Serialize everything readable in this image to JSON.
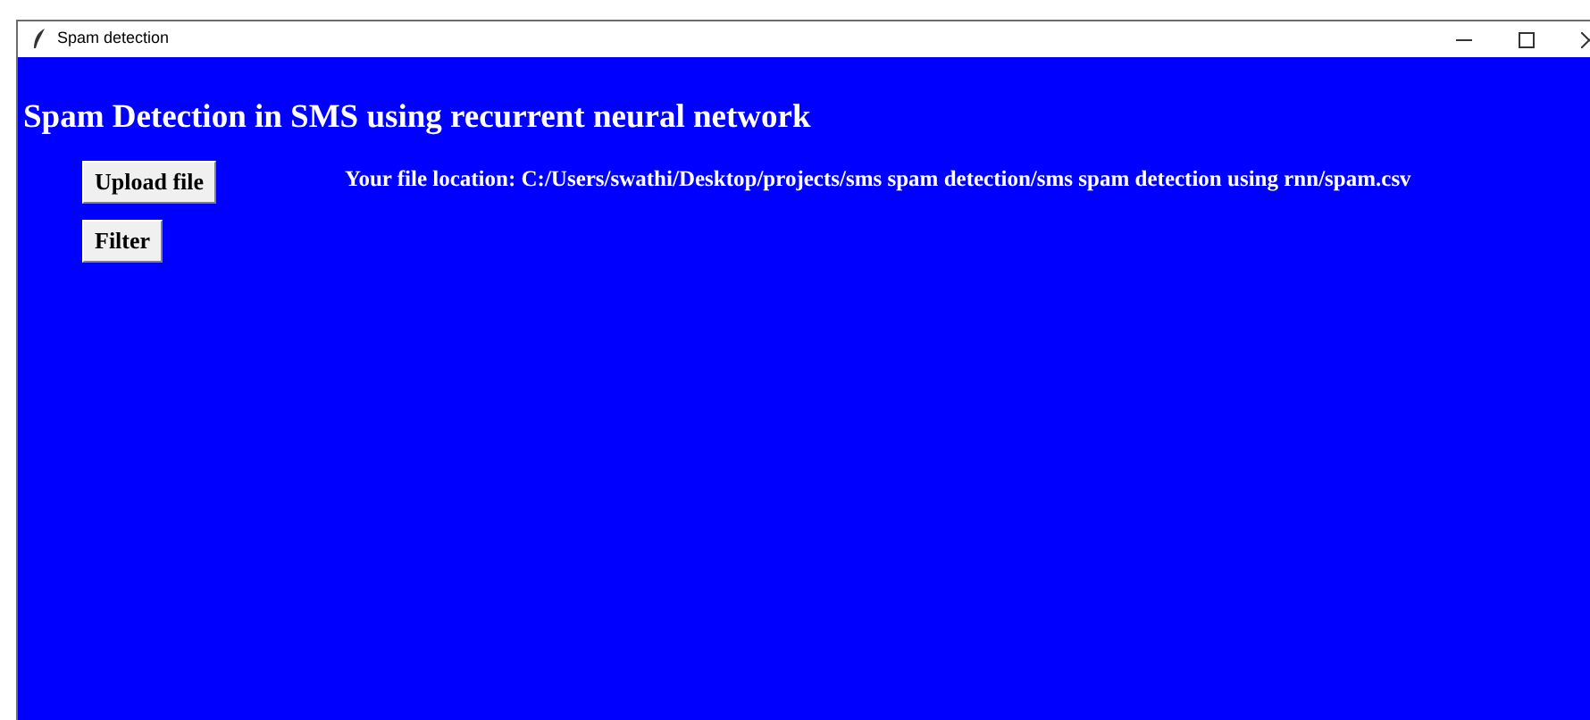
{
  "window": {
    "title": "Spam detection"
  },
  "heading": "Spam Detection in SMS using recurrent neural network",
  "buttons": [
    "Upload file",
    "Filter"
  ],
  "file_location": "Your file location: C:/Users/swathi/Desktop/projects/sms spam detection/sms spam detection using rnn/spam.csv"
}
